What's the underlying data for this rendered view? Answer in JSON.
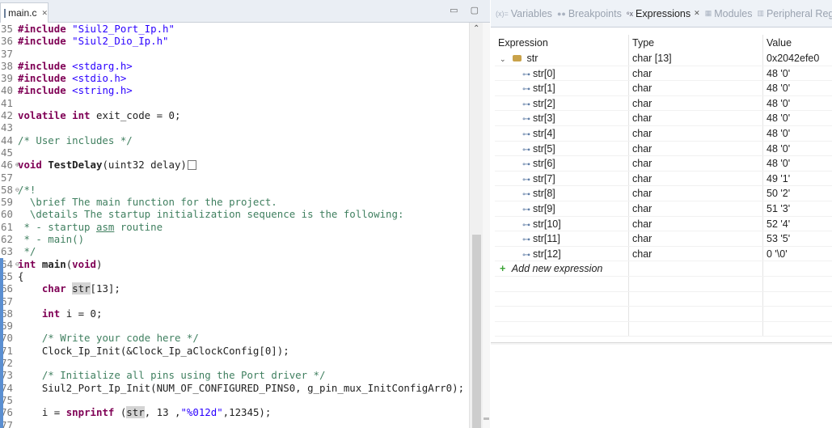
{
  "editor": {
    "tab_label": "main.c",
    "tab_close": "✕",
    "window_controls": "▭ ▢",
    "code_lines": [
      {
        "num": "35",
        "parts": [
          [
            "k",
            "#include "
          ],
          [
            "s",
            "\"Siul2_Port_Ip.h\""
          ]
        ]
      },
      {
        "num": "36",
        "parts": [
          [
            "k",
            "#include "
          ],
          [
            "s",
            "\"Siul2_Dio_Ip.h\""
          ]
        ]
      },
      {
        "num": "37",
        "parts": []
      },
      {
        "num": "38",
        "parts": [
          [
            "k",
            "#include "
          ],
          [
            "s",
            "<stdarg.h>"
          ]
        ]
      },
      {
        "num": "39",
        "parts": [
          [
            "k",
            "#include "
          ],
          [
            "s",
            "<stdio.h>"
          ]
        ]
      },
      {
        "num": "40",
        "parts": [
          [
            "k",
            "#include "
          ],
          [
            "s",
            "<string.h>"
          ]
        ]
      },
      {
        "num": "41",
        "parts": []
      },
      {
        "num": "42",
        "parts": [
          [
            "k",
            "volatile int "
          ],
          [
            "",
            "exit_code = 0;"
          ]
        ]
      },
      {
        "num": "43",
        "parts": []
      },
      {
        "num": "44",
        "parts": [
          [
            "c",
            "/* User includes */"
          ]
        ]
      },
      {
        "num": "45",
        "parts": []
      },
      {
        "num": "46",
        "fold": "⊕",
        "parts": [
          [
            "k",
            "void "
          ],
          [
            "fn",
            "TestDelay"
          ],
          [
            "",
            "(uint32 delay)"
          ],
          [
            "box",
            ""
          ]
        ]
      },
      {
        "num": "57",
        "parts": []
      },
      {
        "num": "58",
        "fold": "⊖",
        "parts": [
          [
            "c",
            "/*!"
          ]
        ]
      },
      {
        "num": "59",
        "parts": [
          [
            "c",
            "  \\brief The main function for the project."
          ]
        ]
      },
      {
        "num": "60",
        "parts": [
          [
            "c",
            "  \\details The startup initialization sequence is the following:"
          ]
        ]
      },
      {
        "num": "61",
        "parts": [
          [
            "c",
            " * - startup "
          ],
          [
            "cu",
            "asm"
          ],
          [
            "c",
            " routine"
          ]
        ]
      },
      {
        "num": "62",
        "parts": [
          [
            "c",
            " * - main()"
          ]
        ]
      },
      {
        "num": "63",
        "parts": [
          [
            "c",
            " */"
          ]
        ]
      },
      {
        "num": "64",
        "fold": "⊖",
        "bar": true,
        "parts": [
          [
            "k",
            "int "
          ],
          [
            "fn",
            "main"
          ],
          [
            "",
            "("
          ],
          [
            "k",
            "void"
          ],
          [
            "",
            ")"
          ]
        ]
      },
      {
        "num": "65",
        "bar": true,
        "parts": [
          [
            "",
            "{"
          ]
        ]
      },
      {
        "num": "66",
        "bar": true,
        "parts": [
          [
            "",
            "    "
          ],
          [
            "k",
            "char "
          ],
          [
            "hl",
            "str"
          ],
          [
            "",
            "[13];"
          ]
        ]
      },
      {
        "num": "67",
        "bar": true,
        "parts": []
      },
      {
        "num": "68",
        "bar": true,
        "parts": [
          [
            "",
            "    "
          ],
          [
            "k",
            "int "
          ],
          [
            "",
            "i = 0;"
          ]
        ]
      },
      {
        "num": "69",
        "bar": true,
        "parts": []
      },
      {
        "num": "70",
        "bar": true,
        "parts": [
          [
            "",
            "    "
          ],
          [
            "c",
            "/* Write your code here */"
          ]
        ]
      },
      {
        "num": "71",
        "bar": true,
        "parts": [
          [
            "",
            "    Clock_Ip_Init(&Clock_Ip_aClockConfig[0]);"
          ]
        ]
      },
      {
        "num": "72",
        "bar": true,
        "parts": []
      },
      {
        "num": "73",
        "bar": true,
        "parts": [
          [
            "",
            "    "
          ],
          [
            "c",
            "/* Initialize all pins using the Port driver */"
          ]
        ]
      },
      {
        "num": "74",
        "bar": true,
        "parts": [
          [
            "",
            "    Siul2_Port_Ip_Init(NUM_OF_CONFIGURED_PINS0, g_pin_mux_InitConfigArr0);"
          ]
        ]
      },
      {
        "num": "75",
        "bar": true,
        "parts": []
      },
      {
        "num": "76",
        "bar": true,
        "parts": [
          [
            "",
            "    i = "
          ],
          [
            "k",
            "snprintf"
          ],
          [
            "",
            " ("
          ],
          [
            "hl",
            "str"
          ],
          [
            "",
            ", 13 ,"
          ],
          [
            "s",
            "\"%012d\""
          ],
          [
            "",
            ",12345);"
          ]
        ]
      },
      {
        "num": "77",
        "bar": true,
        "parts": []
      }
    ]
  },
  "views": {
    "tabs": [
      {
        "label": "Variables",
        "icon": "(x)=",
        "active": false
      },
      {
        "label": "Breakpoints",
        "icon": "●●",
        "active": false
      },
      {
        "label": "Expressions",
        "icon": "⁶x",
        "active": true,
        "close": "✕"
      },
      {
        "label": "Modules",
        "icon": "▦",
        "active": false
      },
      {
        "label": "Peripheral Reg...",
        "icon": "▥",
        "active": false
      }
    ],
    "headers": {
      "expression": "Expression",
      "type": "Type",
      "value": "Value"
    },
    "root": {
      "name": "str",
      "type": "char [13]",
      "value": "0x2042efe0"
    },
    "elements": [
      {
        "name": "str[0]",
        "type": "char",
        "value": "48 '0'"
      },
      {
        "name": "str[1]",
        "type": "char",
        "value": "48 '0'"
      },
      {
        "name": "str[2]",
        "type": "char",
        "value": "48 '0'"
      },
      {
        "name": "str[3]",
        "type": "char",
        "value": "48 '0'"
      },
      {
        "name": "str[4]",
        "type": "char",
        "value": "48 '0'"
      },
      {
        "name": "str[5]",
        "type": "char",
        "value": "48 '0'"
      },
      {
        "name": "str[6]",
        "type": "char",
        "value": "48 '0'"
      },
      {
        "name": "str[7]",
        "type": "char",
        "value": "49 '1'"
      },
      {
        "name": "str[8]",
        "type": "char",
        "value": "50 '2'"
      },
      {
        "name": "str[9]",
        "type": "char",
        "value": "51 '3'"
      },
      {
        "name": "str[10]",
        "type": "char",
        "value": "52 '4'"
      },
      {
        "name": "str[11]",
        "type": "char",
        "value": "53 '5'"
      },
      {
        "name": "str[12]",
        "type": "char",
        "value": "0 '\\0'"
      }
    ],
    "add_label": "Add new expression"
  }
}
